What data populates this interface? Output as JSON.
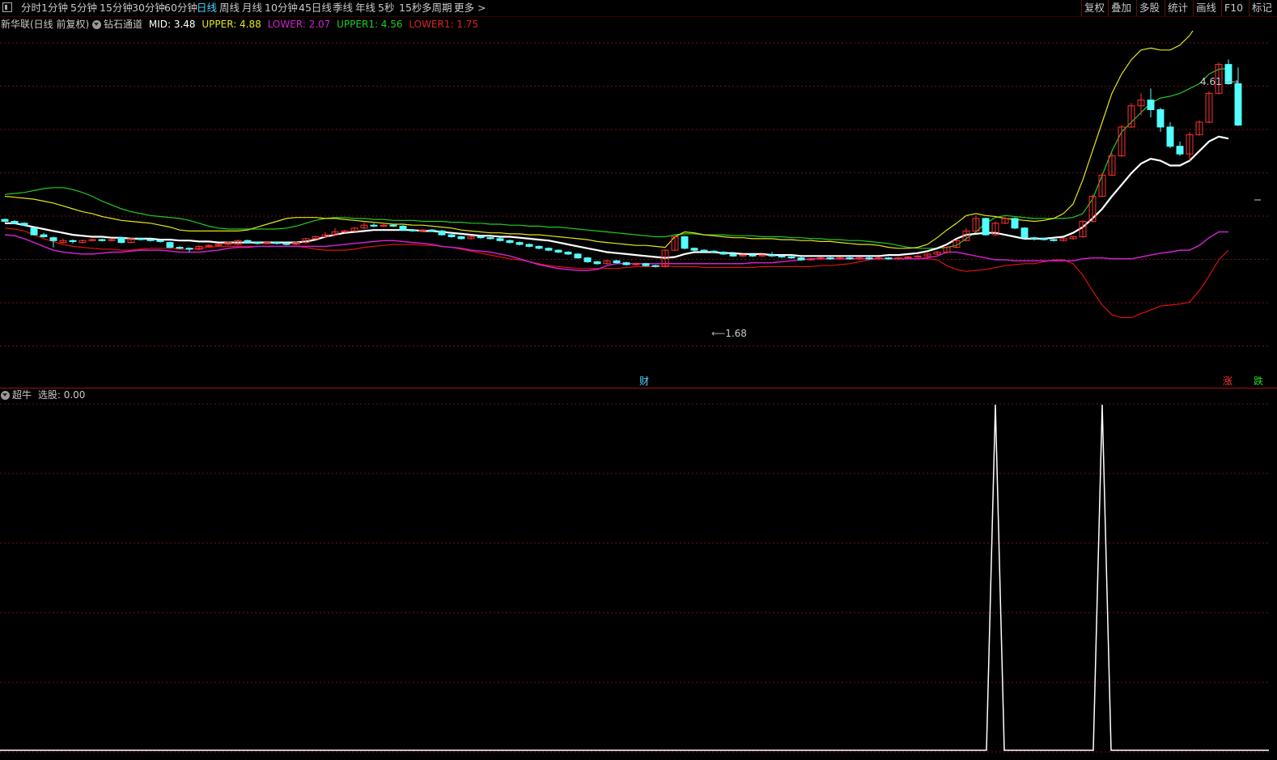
{
  "toolbar": {
    "periods": [
      "分时",
      "1分钟",
      "5分钟",
      "15分钟",
      "30分钟",
      "60分钟",
      "日线",
      "周线",
      "月线",
      "10分钟",
      "45日线",
      "季线",
      "年线",
      "5秒",
      "15秒",
      "多周期",
      "更多 >"
    ],
    "active": "日线",
    "right_buttons": [
      "复权",
      "叠加",
      "多股",
      "统计",
      "画线",
      "F10",
      "标记"
    ]
  },
  "main_panel": {
    "stock_title": "新华联(日线 前复权)",
    "indicator_name": "钻石通道",
    "mid_label": "MID: 3.48",
    "upper_label": "UPPER: 4.88",
    "lower_label": "LOWER: 2.07",
    "upper1_label": "UPPER1: 4.56",
    "lower1_label": "LOWER1: 1.75",
    "high_marker": "4.61",
    "low_marker": "1.68",
    "finance_marker": "财",
    "limit_up_marker": "涨",
    "limit_down_marker": "跌"
  },
  "sub_panel": {
    "indicator_name": "超牛",
    "select_label": "选股: 0.00"
  },
  "colors": {
    "upper": "#e6e619",
    "upper1": "#22cc22",
    "lower": "#cc22cc",
    "lower1": "#dd1111",
    "mid": "#ffffff",
    "candle_up": "#ff3232",
    "candle_down": "#54ffff",
    "grid": "#7a1010",
    "active_tab": "#4fd4ff"
  },
  "chart_data": {
    "type": "candlestick",
    "indicator": "钻石通道",
    "y_range": [
      1.3,
      5.0
    ],
    "candles": [
      [
        3.04,
        3.02,
        3.05,
        3.01
      ],
      [
        3.02,
        3.0,
        3.03,
        2.99
      ],
      [
        3.0,
        2.98,
        3.01,
        2.97
      ],
      [
        2.95,
        2.88,
        2.96,
        2.87
      ],
      [
        2.88,
        2.86,
        2.9,
        2.85
      ],
      [
        2.85,
        2.82,
        2.86,
        2.75
      ],
      [
        2.8,
        2.82,
        2.84,
        2.79
      ],
      [
        2.82,
        2.81,
        2.83,
        2.79
      ],
      [
        2.8,
        2.82,
        2.83,
        2.79
      ],
      [
        2.82,
        2.83,
        2.84,
        2.81
      ],
      [
        2.83,
        2.82,
        2.84,
        2.81
      ],
      [
        2.82,
        2.83,
        2.84,
        2.81
      ],
      [
        2.85,
        2.8,
        2.86,
        2.79
      ],
      [
        2.8,
        2.84,
        2.85,
        2.79
      ],
      [
        2.84,
        2.83,
        2.85,
        2.82
      ],
      [
        2.83,
        2.82,
        2.84,
        2.81
      ],
      [
        2.82,
        2.81,
        2.83,
        2.8
      ],
      [
        2.8,
        2.75,
        2.81,
        2.74
      ],
      [
        2.75,
        2.74,
        2.76,
        2.73
      ],
      [
        2.74,
        2.73,
        2.75,
        2.7
      ],
      [
        2.73,
        2.76,
        2.77,
        2.72
      ],
      [
        2.76,
        2.77,
        2.78,
        2.75
      ],
      [
        2.77,
        2.78,
        2.79,
        2.76
      ],
      [
        2.78,
        2.8,
        2.81,
        2.77
      ],
      [
        2.78,
        2.82,
        2.83,
        2.77
      ],
      [
        2.82,
        2.8,
        2.83,
        2.79
      ],
      [
        2.8,
        2.79,
        2.81,
        2.78
      ],
      [
        2.79,
        2.8,
        2.81,
        2.78
      ],
      [
        2.8,
        2.79,
        2.81,
        2.78
      ],
      [
        2.79,
        2.78,
        2.8,
        2.77
      ],
      [
        2.78,
        2.8,
        2.81,
        2.77
      ],
      [
        2.8,
        2.84,
        2.85,
        2.79
      ],
      [
        2.84,
        2.86,
        2.87,
        2.83
      ],
      [
        2.86,
        2.88,
        2.91,
        2.85
      ],
      [
        2.88,
        2.91,
        2.95,
        2.87
      ],
      [
        2.91,
        2.92,
        2.93,
        2.9
      ],
      [
        2.92,
        2.95,
        2.96,
        2.91
      ],
      [
        2.95,
        2.98,
        3.02,
        2.94
      ],
      [
        2.98,
        2.97,
        3.0,
        2.96
      ],
      [
        2.97,
        2.98,
        2.99,
        2.96
      ],
      [
        2.98,
        2.97,
        2.99,
        2.96
      ],
      [
        2.97,
        2.93,
        2.98,
        2.92
      ],
      [
        2.93,
        2.92,
        2.94,
        2.91
      ],
      [
        2.92,
        2.93,
        2.94,
        2.91
      ],
      [
        2.93,
        2.92,
        2.94,
        2.91
      ],
      [
        2.92,
        2.88,
        2.93,
        2.87
      ],
      [
        2.88,
        2.86,
        2.89,
        2.85
      ],
      [
        2.86,
        2.84,
        2.87,
        2.83
      ],
      [
        2.84,
        2.86,
        2.87,
        2.83
      ],
      [
        2.86,
        2.85,
        2.87,
        2.84
      ],
      [
        2.85,
        2.84,
        2.86,
        2.83
      ],
      [
        2.84,
        2.82,
        2.85,
        2.81
      ],
      [
        2.82,
        2.8,
        2.83,
        2.79
      ],
      [
        2.8,
        2.78,
        2.81,
        2.77
      ],
      [
        2.78,
        2.76,
        2.79,
        2.75
      ],
      [
        2.76,
        2.74,
        2.77,
        2.73
      ],
      [
        2.74,
        2.72,
        2.75,
        2.71
      ],
      [
        2.72,
        2.7,
        2.73,
        2.69
      ],
      [
        2.7,
        2.68,
        2.71,
        2.67
      ],
      [
        2.68,
        2.64,
        2.69,
        2.63
      ],
      [
        2.64,
        2.6,
        2.65,
        2.59
      ],
      [
        2.6,
        2.58,
        2.61,
        2.57
      ],
      [
        2.58,
        2.61,
        2.62,
        2.57
      ],
      [
        2.61,
        2.59,
        2.62,
        2.58
      ],
      [
        2.59,
        2.57,
        2.6,
        2.56
      ],
      [
        2.57,
        2.58,
        2.59,
        2.56
      ],
      [
        2.58,
        2.56,
        2.59,
        2.55
      ],
      [
        2.56,
        2.55,
        2.57,
        2.54
      ],
      [
        2.55,
        2.72,
        2.73,
        2.54
      ],
      [
        2.72,
        2.86,
        2.87,
        2.71
      ],
      [
        2.86,
        2.74,
        2.87,
        2.73
      ],
      [
        2.74,
        2.72,
        2.75,
        2.71
      ],
      [
        2.72,
        2.71,
        2.73,
        2.7
      ],
      [
        2.71,
        2.7,
        2.72,
        2.69
      ],
      [
        2.7,
        2.68,
        2.71,
        2.67
      ],
      [
        2.68,
        2.66,
        2.69,
        2.65
      ],
      [
        2.66,
        2.67,
        2.68,
        2.65
      ],
      [
        2.67,
        2.66,
        2.68,
        2.65
      ],
      [
        2.66,
        2.67,
        2.68,
        2.65
      ],
      [
        2.67,
        2.66,
        2.7,
        2.65
      ],
      [
        2.66,
        2.65,
        2.67,
        2.64
      ],
      [
        2.65,
        2.64,
        2.66,
        2.63
      ],
      [
        2.64,
        2.62,
        2.65,
        2.61
      ],
      [
        2.62,
        2.63,
        2.64,
        2.61
      ],
      [
        2.63,
        2.64,
        2.65,
        2.62
      ],
      [
        2.64,
        2.63,
        2.65,
        2.62
      ],
      [
        2.63,
        2.64,
        2.65,
        2.62
      ],
      [
        2.64,
        2.63,
        2.65,
        2.62
      ],
      [
        2.63,
        2.64,
        2.65,
        2.62
      ],
      [
        2.64,
        2.63,
        2.65,
        2.62
      ],
      [
        2.63,
        2.64,
        2.65,
        2.62
      ],
      [
        2.64,
        2.63,
        2.65,
        2.62
      ],
      [
        2.63,
        2.64,
        2.65,
        2.62
      ],
      [
        2.64,
        2.65,
        2.66,
        2.63
      ],
      [
        2.65,
        2.66,
        2.67,
        2.64
      ],
      [
        2.66,
        2.68,
        2.69,
        2.65
      ],
      [
        2.68,
        2.7,
        2.71,
        2.67
      ],
      [
        2.7,
        2.75,
        2.76,
        2.69
      ],
      [
        2.75,
        2.82,
        2.83,
        2.74
      ],
      [
        2.82,
        2.92,
        2.95,
        2.81
      ],
      [
        2.92,
        3.05,
        3.08,
        2.91
      ],
      [
        3.05,
        2.88,
        3.06,
        2.87
      ],
      [
        2.88,
        3.0,
        3.02,
        2.87
      ],
      [
        3.0,
        3.05,
        3.07,
        2.99
      ],
      [
        3.05,
        2.95,
        3.06,
        2.94
      ],
      [
        2.95,
        2.85,
        2.96,
        2.84
      ],
      [
        2.85,
        2.84,
        2.86,
        2.82
      ],
      [
        2.84,
        2.83,
        2.85,
        2.82
      ],
      [
        2.83,
        2.82,
        2.84,
        2.81
      ],
      [
        2.82,
        2.84,
        2.85,
        2.81
      ],
      [
        2.84,
        2.86,
        2.87,
        2.83
      ],
      [
        2.86,
        3.02,
        3.03,
        2.85
      ],
      [
        3.02,
        3.28,
        3.3,
        3.01
      ],
      [
        3.28,
        3.5,
        3.52,
        3.27
      ],
      [
        3.5,
        3.7,
        3.73,
        3.49
      ],
      [
        3.7,
        4.0,
        4.02,
        3.69
      ],
      [
        4.0,
        4.22,
        4.25,
        3.99
      ],
      [
        4.22,
        4.28,
        4.35,
        4.12
      ],
      [
        4.28,
        4.18,
        4.4,
        4.1
      ],
      [
        4.18,
        4.0,
        4.2,
        3.95
      ],
      [
        4.0,
        3.8,
        4.05,
        3.78
      ],
      [
        3.8,
        3.72,
        3.85,
        3.7
      ],
      [
        3.72,
        3.92,
        3.95,
        3.65
      ],
      [
        3.92,
        4.05,
        4.07,
        3.91
      ],
      [
        4.05,
        4.35,
        4.37,
        4.04
      ],
      [
        4.35,
        4.65,
        4.67,
        4.34
      ],
      [
        4.65,
        4.45,
        4.7,
        4.44
      ],
      [
        4.45,
        4.02,
        4.62,
        4.01
      ]
    ],
    "mid": [
      3.0,
      3.0,
      2.98,
      2.96,
      2.94,
      2.92,
      2.9,
      2.88,
      2.87,
      2.86,
      2.86,
      2.85,
      2.85,
      2.84,
      2.84,
      2.84,
      2.83,
      2.83,
      2.82,
      2.82,
      2.81,
      2.81,
      2.8,
      2.8,
      2.8,
      2.8,
      2.8,
      2.8,
      2.8,
      2.8,
      2.8,
      2.81,
      2.83,
      2.86,
      2.88,
      2.9,
      2.91,
      2.92,
      2.93,
      2.93,
      2.93,
      2.93,
      2.93,
      2.92,
      2.92,
      2.91,
      2.9,
      2.89,
      2.88,
      2.87,
      2.87,
      2.86,
      2.86,
      2.85,
      2.84,
      2.83,
      2.82,
      2.8,
      2.78,
      2.76,
      2.74,
      2.72,
      2.7,
      2.69,
      2.68,
      2.67,
      2.66,
      2.65,
      2.64,
      2.65,
      2.68,
      2.7,
      2.7,
      2.7,
      2.69,
      2.69,
      2.68,
      2.68,
      2.68,
      2.67,
      2.67,
      2.67,
      2.66,
      2.66,
      2.66,
      2.66,
      2.66,
      2.66,
      2.66,
      2.66,
      2.66,
      2.67,
      2.67,
      2.68,
      2.69,
      2.71,
      2.74,
      2.78,
      2.84,
      2.88,
      2.89,
      2.9,
      2.9,
      2.88,
      2.86,
      2.84,
      2.84,
      2.84,
      2.85,
      2.86,
      2.9,
      2.96,
      3.05,
      3.15,
      3.28,
      3.4,
      3.52,
      3.62,
      3.67,
      3.65,
      3.6,
      3.6,
      3.65,
      3.75,
      3.85,
      3.9,
      3.88
    ],
    "upper": [
      3.28,
      3.27,
      3.26,
      3.25,
      3.23,
      3.21,
      3.18,
      3.15,
      3.12,
      3.1,
      3.07,
      3.05,
      3.03,
      3.02,
      3.01,
      3.0,
      2.98,
      2.96,
      2.93,
      2.92,
      2.92,
      2.92,
      2.92,
      2.92,
      2.92,
      2.93,
      2.96,
      2.99,
      3.02,
      3.05,
      3.06,
      3.06,
      3.06,
      3.05,
      3.05,
      3.04,
      3.03,
      3.02,
      3.01,
      3.0,
      2.99,
      2.99,
      2.98,
      2.98,
      2.97,
      2.96,
      2.95,
      2.93,
      2.92,
      2.91,
      2.9,
      2.9,
      2.89,
      2.89,
      2.88,
      2.88,
      2.87,
      2.86,
      2.85,
      2.84,
      2.83,
      2.81,
      2.8,
      2.79,
      2.78,
      2.77,
      2.77,
      2.76,
      2.75,
      2.86,
      2.91,
      2.9,
      2.88,
      2.87,
      2.86,
      2.85,
      2.85,
      2.84,
      2.84,
      2.84,
      2.83,
      2.83,
      2.82,
      2.82,
      2.81,
      2.81,
      2.8,
      2.79,
      2.78,
      2.78,
      2.77,
      2.75,
      2.74,
      2.74,
      2.75,
      2.78,
      2.85,
      2.93,
      3.0,
      3.08,
      3.1,
      3.08,
      3.07,
      3.05,
      3.04,
      3.03,
      3.02,
      3.03,
      3.05,
      3.1,
      3.2,
      3.45,
      3.75,
      4.05,
      4.35,
      4.55,
      4.7,
      4.8,
      4.82,
      4.8,
      4.8,
      4.85,
      4.95,
      5.1,
      5.25,
      5.22,
      5.05
    ],
    "lower": [
      2.88,
      2.87,
      2.84,
      2.8,
      2.76,
      2.72,
      2.7,
      2.69,
      2.68,
      2.68,
      2.69,
      2.7,
      2.7,
      2.71,
      2.72,
      2.72,
      2.72,
      2.71,
      2.7,
      2.7,
      2.7,
      2.71,
      2.72,
      2.74,
      2.75,
      2.75,
      2.76,
      2.76,
      2.76,
      2.76,
      2.76,
      2.76,
      2.76,
      2.76,
      2.77,
      2.78,
      2.79,
      2.8,
      2.81,
      2.82,
      2.82,
      2.81,
      2.8,
      2.79,
      2.78,
      2.76,
      2.75,
      2.74,
      2.72,
      2.71,
      2.7,
      2.68,
      2.66,
      2.63,
      2.6,
      2.57,
      2.55,
      2.53,
      2.52,
      2.51,
      2.51,
      2.52,
      2.56,
      2.58,
      2.58,
      2.58,
      2.58,
      2.58,
      2.58,
      2.58,
      2.58,
      2.58,
      2.58,
      2.58,
      2.58,
      2.58,
      2.58,
      2.59,
      2.59,
      2.59,
      2.6,
      2.61,
      2.62,
      2.63,
      2.63,
      2.63,
      2.63,
      2.63,
      2.63,
      2.63,
      2.63,
      2.63,
      2.63,
      2.63,
      2.63,
      2.64,
      2.66,
      2.7,
      2.7,
      2.68,
      2.66,
      2.64,
      2.62,
      2.62,
      2.61,
      2.61,
      2.61,
      2.61,
      2.61,
      2.61,
      2.61,
      2.63,
      2.64,
      2.64,
      2.63,
      2.63,
      2.63,
      2.65,
      2.67,
      2.69,
      2.7,
      2.72,
      2.72,
      2.77,
      2.85,
      2.91,
      2.91
    ],
    "upper1": [
      3.3,
      3.31,
      3.32,
      3.34,
      3.36,
      3.37,
      3.37,
      3.35,
      3.32,
      3.28,
      3.23,
      3.19,
      3.15,
      3.12,
      3.1,
      3.08,
      3.07,
      3.06,
      3.05,
      3.03,
      3.0,
      2.97,
      2.95,
      2.94,
      2.94,
      2.94,
      2.94,
      2.94,
      2.94,
      2.95,
      2.97,
      3.0,
      3.03,
      3.05,
      3.06,
      3.06,
      3.05,
      3.05,
      3.04,
      3.04,
      3.03,
      3.03,
      3.03,
      3.02,
      3.02,
      3.02,
      3.01,
      3.01,
      3.0,
      3.0,
      2.99,
      2.99,
      2.98,
      2.98,
      2.97,
      2.97,
      2.96,
      2.96,
      2.95,
      2.94,
      2.93,
      2.92,
      2.91,
      2.9,
      2.89,
      2.88,
      2.87,
      2.86,
      2.86,
      2.88,
      2.89,
      2.89,
      2.88,
      2.88,
      2.88,
      2.87,
      2.87,
      2.87,
      2.86,
      2.86,
      2.86,
      2.85,
      2.85,
      2.84,
      2.84,
      2.83,
      2.83,
      2.82,
      2.82,
      2.81,
      2.8,
      2.79,
      2.77,
      2.75,
      2.74,
      2.74,
      2.74,
      2.75,
      2.77,
      2.84,
      2.91,
      3.0,
      3.06,
      3.08,
      3.07,
      3.06,
      3.05,
      3.05,
      3.05,
      3.05,
      3.06,
      3.1,
      3.25,
      3.5,
      3.75,
      3.95,
      4.05,
      4.15,
      4.25,
      4.3,
      4.32,
      4.35,
      4.4,
      4.45,
      4.55,
      4.6,
      4.61
    ],
    "lower1": [
      2.95,
      2.94,
      2.92,
      2.88,
      2.84,
      2.81,
      2.78,
      2.76,
      2.75,
      2.74,
      2.73,
      2.73,
      2.72,
      2.72,
      2.73,
      2.74,
      2.74,
      2.74,
      2.73,
      2.73,
      2.74,
      2.75,
      2.76,
      2.76,
      2.76,
      2.76,
      2.76,
      2.76,
      2.76,
      2.76,
      2.76,
      2.75,
      2.73,
      2.72,
      2.72,
      2.72,
      2.73,
      2.75,
      2.76,
      2.77,
      2.78,
      2.78,
      2.78,
      2.77,
      2.77,
      2.76,
      2.75,
      2.73,
      2.71,
      2.69,
      2.67,
      2.65,
      2.63,
      2.62,
      2.6,
      2.58,
      2.56,
      2.55,
      2.54,
      2.53,
      2.53,
      2.53,
      2.53,
      2.53,
      2.54,
      2.55,
      2.55,
      2.55,
      2.56,
      2.55,
      2.55,
      2.55,
      2.54,
      2.54,
      2.54,
      2.54,
      2.54,
      2.54,
      2.55,
      2.55,
      2.55,
      2.55,
      2.55,
      2.55,
      2.56,
      2.56,
      2.57,
      2.58,
      2.6,
      2.62,
      2.63,
      2.63,
      2.63,
      2.63,
      2.63,
      2.63,
      2.62,
      2.56,
      2.52,
      2.5,
      2.51,
      2.52,
      2.54,
      2.56,
      2.57,
      2.58,
      2.58,
      2.6,
      2.62,
      2.62,
      2.58,
      2.46,
      2.3,
      2.15,
      2.05,
      2.02,
      2.02,
      2.06,
      2.1,
      2.14,
      2.15,
      2.16,
      2.18,
      2.3,
      2.45,
      2.62,
      2.72
    ],
    "signal": {
      "indicator": "超牛",
      "y_range": [
        0,
        1
      ],
      "spikes_at_candle": [
        102,
        113
      ],
      "value": 0.0
    }
  }
}
